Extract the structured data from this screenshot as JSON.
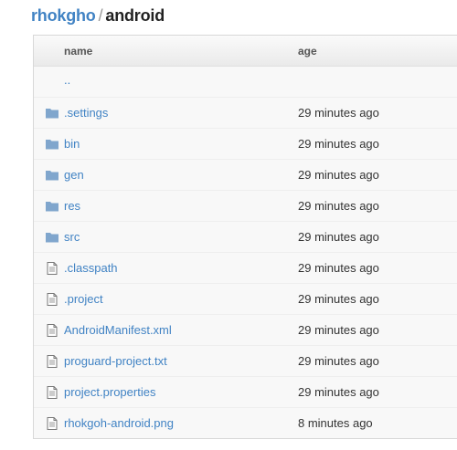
{
  "breadcrumb": {
    "owner": "rhokgho",
    "separator": "/",
    "repo": "android"
  },
  "table": {
    "columns": {
      "name": "name",
      "age": "age"
    },
    "parent_link": "..",
    "rows": [
      {
        "name": ".settings",
        "age": "29 minutes ago",
        "icon": "folder-icon"
      },
      {
        "name": "bin",
        "age": "29 minutes ago",
        "icon": "folder-icon"
      },
      {
        "name": "gen",
        "age": "29 minutes ago",
        "icon": "folder-icon"
      },
      {
        "name": "res",
        "age": "29 minutes ago",
        "icon": "folder-icon"
      },
      {
        "name": "src",
        "age": "29 minutes ago",
        "icon": "folder-icon"
      },
      {
        "name": ".classpath",
        "age": "29 minutes ago",
        "icon": "file-icon"
      },
      {
        "name": ".project",
        "age": "29 minutes ago",
        "icon": "file-icon"
      },
      {
        "name": "AndroidManifest.xml",
        "age": "29 minutes ago",
        "icon": "file-icon"
      },
      {
        "name": "proguard-project.txt",
        "age": "29 minutes ago",
        "icon": "file-icon"
      },
      {
        "name": "project.properties",
        "age": "29 minutes ago",
        "icon": "file-icon"
      },
      {
        "name": "rhokgoh-android.png",
        "age": "8 minutes ago",
        "icon": "file-icon"
      }
    ]
  },
  "colors": {
    "link": "#4183c4",
    "folder": "#80a6cd",
    "file_icon": "#777777"
  }
}
